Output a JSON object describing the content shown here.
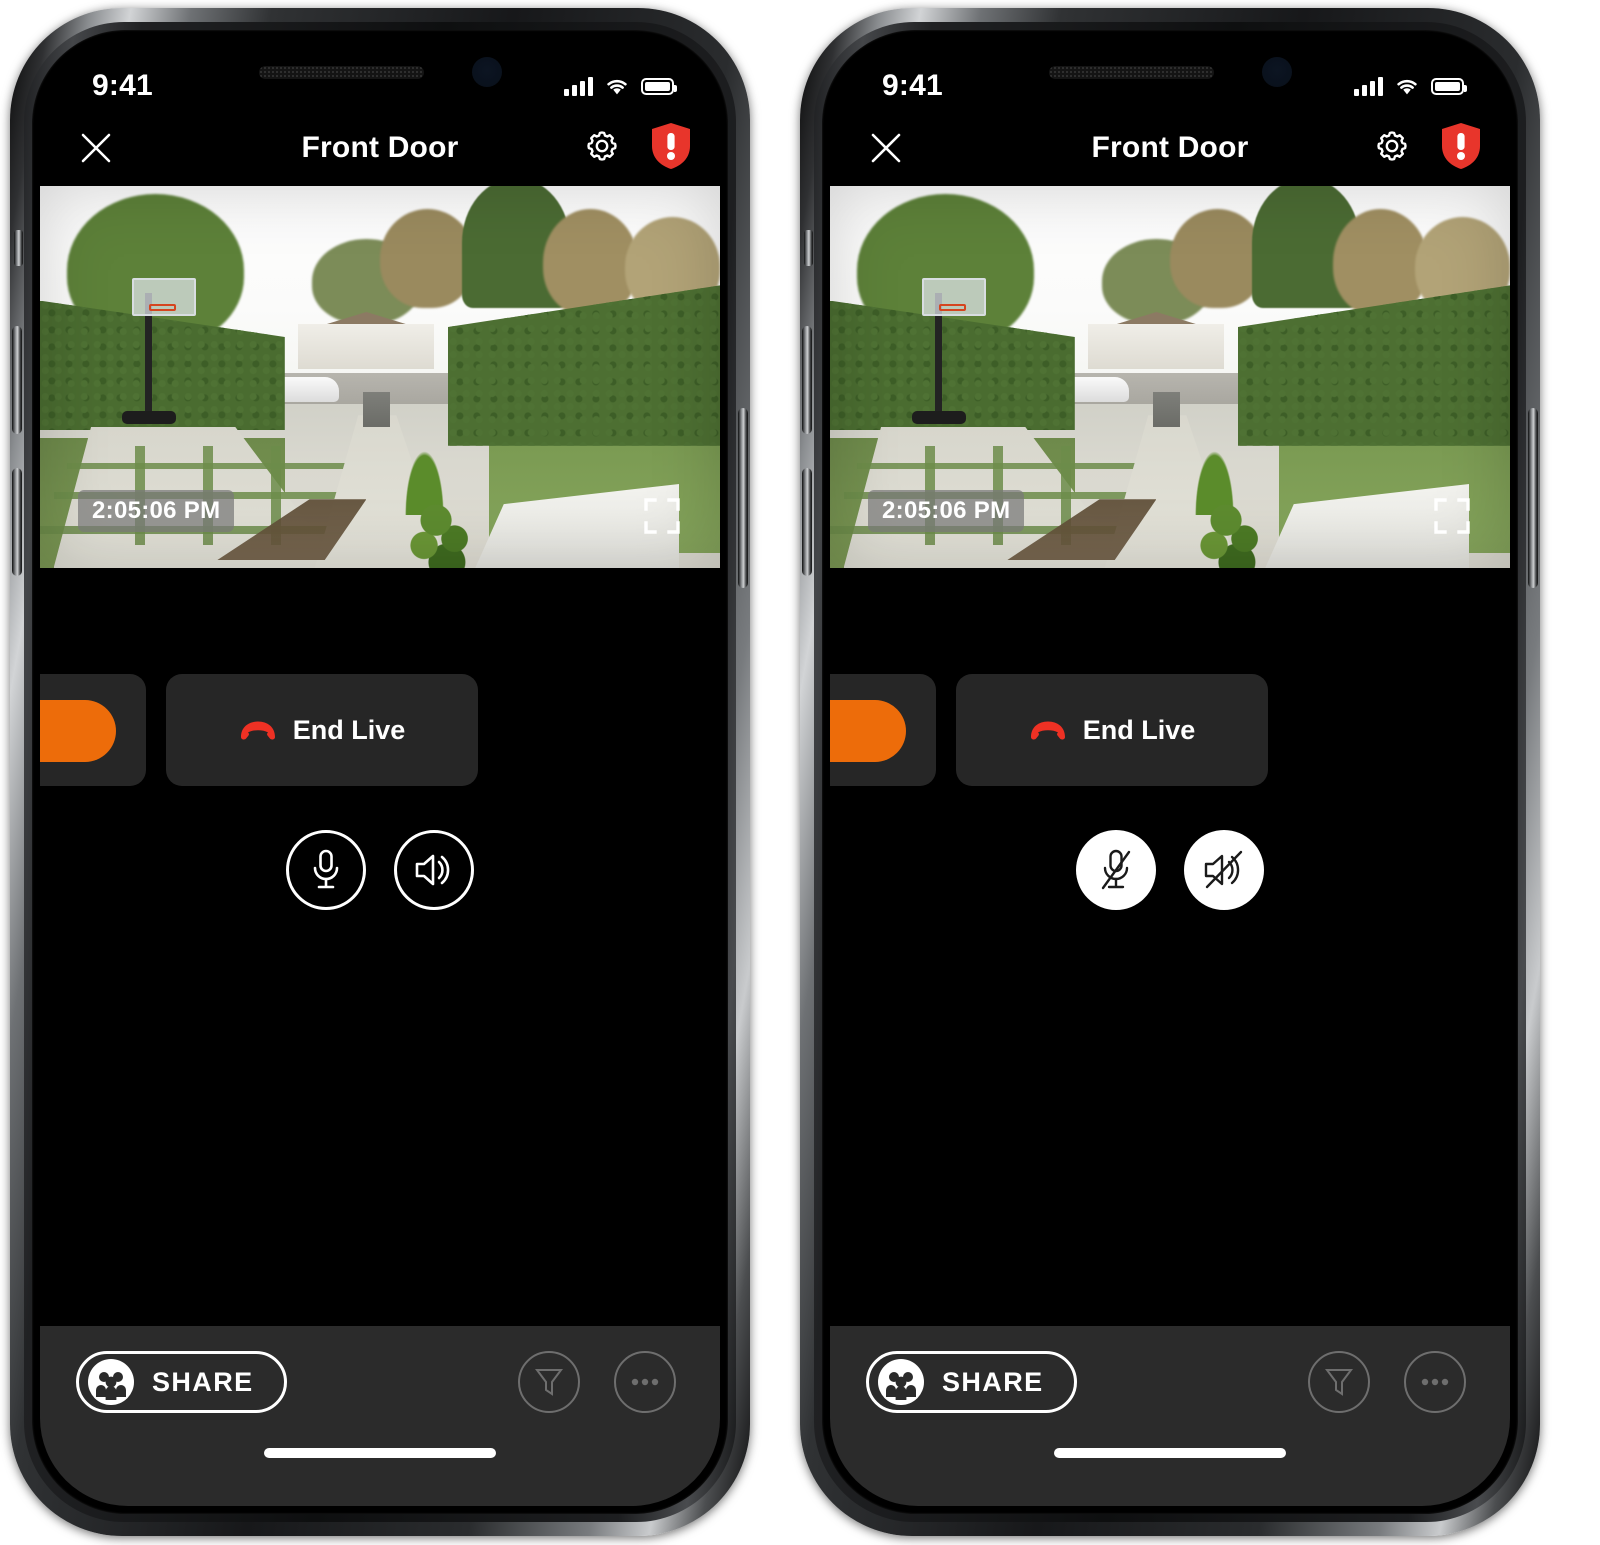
{
  "app": {
    "screens": [
      {
        "id": "unmuted",
        "status_bar": {
          "time": "9:41",
          "signal_icon": "cellular-bars-icon",
          "wifi_icon": "wifi-icon",
          "battery_icon": "battery-full-icon"
        },
        "nav": {
          "close_icon": "close-icon",
          "title": "Front Door",
          "settings_icon": "gear-icon",
          "alert_icon": "shield-alert-icon",
          "alert_color": "#E8352B"
        },
        "video": {
          "timestamp": "2:05:06 PM",
          "fullscreen_icon": "fullscreen-icon"
        },
        "controls": {
          "orange_action_color": "#ED6C0A",
          "end_live_label": "End Live",
          "end_live_icon": "phone-hangup-icon",
          "end_live_icon_color": "#EE3124",
          "mic_icon": "microphone-icon",
          "mic_state": "on",
          "speaker_icon": "speaker-icon",
          "speaker_state": "on"
        },
        "bottom_bar": {
          "share_label": "SHARE",
          "share_icon": "people-group-icon",
          "filter_icon": "filter-funnel-icon",
          "more_icon": "more-ellipsis-icon",
          "home_indicator": "home-indicator"
        }
      },
      {
        "id": "muted",
        "status_bar": {
          "time": "9:41",
          "signal_icon": "cellular-bars-icon",
          "wifi_icon": "wifi-icon",
          "battery_icon": "battery-full-icon"
        },
        "nav": {
          "close_icon": "close-icon",
          "title": "Front Door",
          "settings_icon": "gear-icon",
          "alert_icon": "shield-alert-icon",
          "alert_color": "#E8352B"
        },
        "video": {
          "timestamp": "2:05:06 PM",
          "fullscreen_icon": "fullscreen-icon"
        },
        "controls": {
          "orange_action_color": "#ED6C0A",
          "end_live_label": "End Live",
          "end_live_icon": "phone-hangup-icon",
          "end_live_icon_color": "#EE3124",
          "mic_icon": "microphone-muted-icon",
          "mic_state": "off",
          "speaker_icon": "speaker-muted-icon",
          "speaker_state": "off"
        },
        "bottom_bar": {
          "share_label": "SHARE",
          "share_icon": "people-group-icon",
          "filter_icon": "filter-funnel-icon",
          "more_icon": "more-ellipsis-icon",
          "home_indicator": "home-indicator"
        }
      }
    ]
  }
}
